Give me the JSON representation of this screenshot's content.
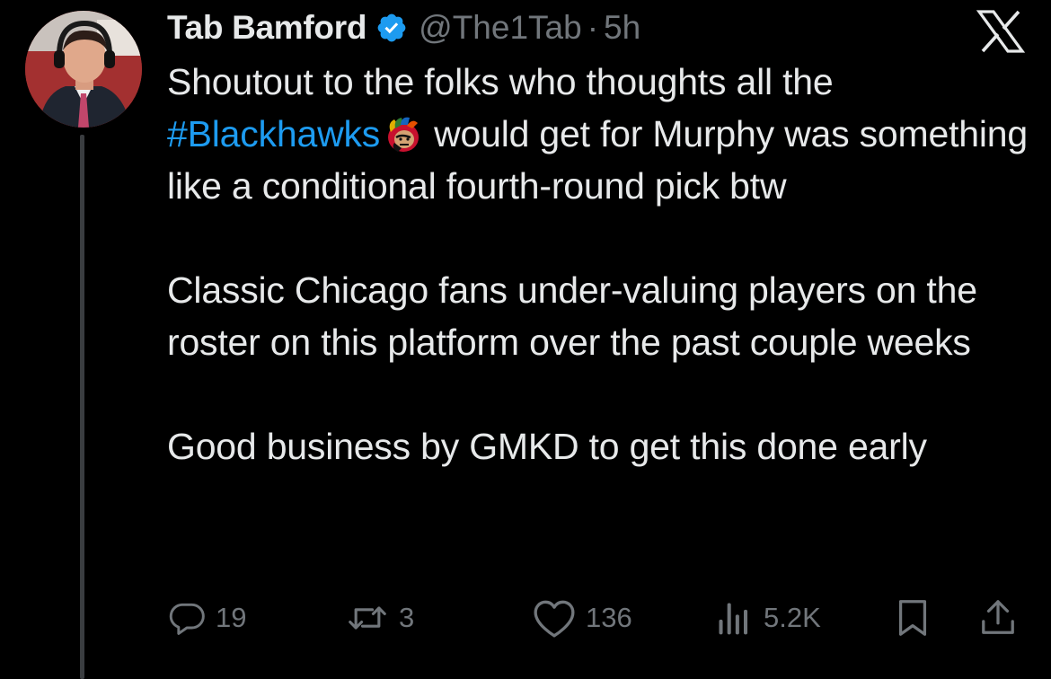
{
  "tweet": {
    "author_name": "Tab Bamford",
    "handle": "@The1Tab",
    "separator": "·",
    "timestamp": "5h",
    "paragraph1_before": "Shoutout to the folks who thoughts all the",
    "hashtag": "#Blackhawks",
    "paragraph1_after": "would get for Murphy was something like a conditional fourth-round pick btw",
    "paragraph2": "Classic Chicago fans under-valuing players on the roster on this platform over the past couple weeks",
    "paragraph3": "Good business by GMKD to get this done early"
  },
  "actions": {
    "replies": "19",
    "reposts": "3",
    "likes": "136",
    "views": "5.2K"
  },
  "icons": {
    "reply": "reply-icon",
    "repost": "repost-icon",
    "like": "heart-icon",
    "views": "views-icon",
    "bookmark": "bookmark-icon",
    "share": "share-icon",
    "brand": "x-logo-icon",
    "verified": "verified-badge-icon",
    "hashtag_emoji": "blackhawks-logo-icon"
  },
  "colors": {
    "background": "#000000",
    "text": "#e7e9ea",
    "muted": "#71767b",
    "accent": "#1d9bf0",
    "thread_line": "#3a3d40"
  }
}
